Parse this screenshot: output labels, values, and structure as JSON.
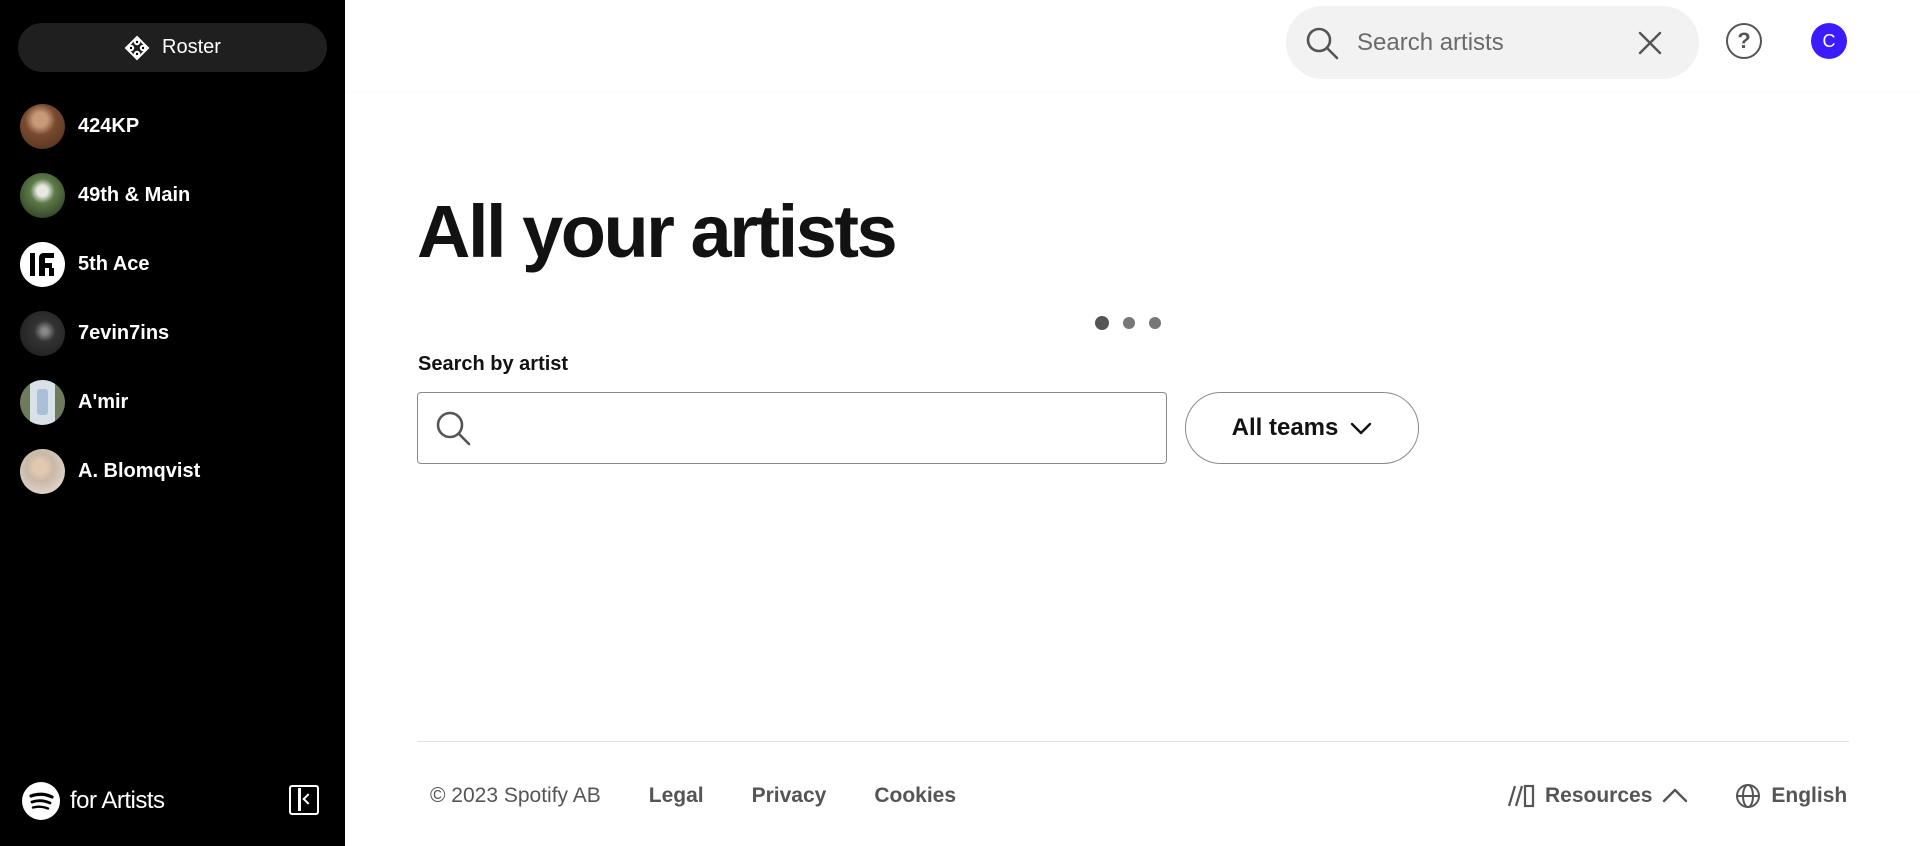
{
  "sidebar": {
    "roster_label": "Roster",
    "artists": [
      {
        "name": "424KP",
        "avatar_color": "#8a5a3c"
      },
      {
        "name": "49th & Main",
        "avatar_color": "#3d5a3a"
      },
      {
        "name": "5th Ace",
        "avatar_color": "#ffffff"
      },
      {
        "name": "7evin7ins",
        "avatar_color": "#2a2a2a"
      },
      {
        "name": "A'mir",
        "avatar_color": "#8a9a7a"
      },
      {
        "name": "A. Blomqvist",
        "avatar_color": "#d8cfc2"
      }
    ],
    "footer_brand": "for Artists"
  },
  "topbar": {
    "search_placeholder": "Search artists",
    "help_icon": "?",
    "user_initial": "C"
  },
  "main": {
    "title": "All your artists",
    "search_label": "Search by artist",
    "teams_label": "All teams"
  },
  "footer": {
    "copyright": "© 2023 Spotify AB",
    "links": [
      "Legal",
      "Privacy",
      "Cookies"
    ],
    "resources": "Resources",
    "language": "English"
  },
  "colors": {
    "sidebar_bg": "#000000",
    "avatar_accent": "#3b1cff"
  }
}
